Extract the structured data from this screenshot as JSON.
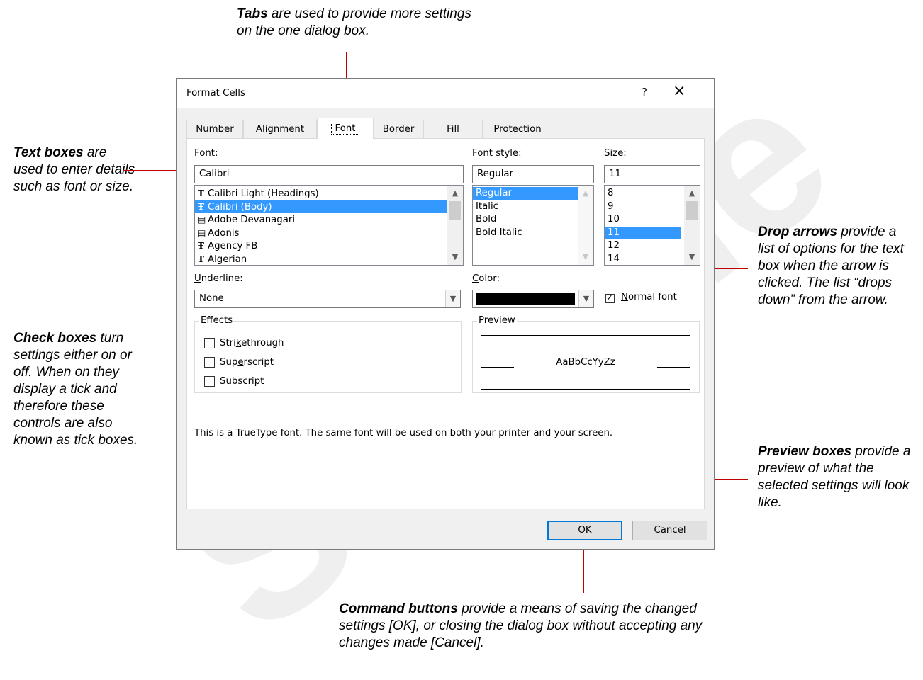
{
  "annotations": {
    "tabs": {
      "bold": "Tabs",
      "text": " are used to provide more settings on the one dialog box."
    },
    "text_boxes": {
      "bold": "Text boxes",
      "text": " are used to enter details such as font or size."
    },
    "check_boxes": {
      "bold": "Check boxes",
      "text": " turn settings either on or off. When on they display a tick and therefore these controls are also known as tick boxes."
    },
    "drop_arrows": {
      "bold": "Drop arrows",
      "text": " provide a list of options for the text box when the arrow is clicked. The list “drops down” from the arrow."
    },
    "preview_boxes": {
      "bold": "Preview boxes",
      "text": " provide a preview of what the selected settings will look like."
    },
    "command_buttons": {
      "bold": "Command buttons",
      "text": " provide a means of saving the changed settings [OK], or closing the dialog box without accepting any changes made [Cancel]."
    }
  },
  "dialog": {
    "title": "Format Cells",
    "help": "?",
    "close": "×",
    "tabs": [
      "Number",
      "Alignment",
      "Font",
      "Border",
      "Fill",
      "Protection"
    ],
    "active_tab": "Font",
    "font": {
      "label_u": "F",
      "label_rest": "ont:",
      "value": "Calibri",
      "items": [
        "Calibri Light (Headings)",
        "Calibri (Body)",
        "Adobe Devanagari",
        "Adonis",
        "Agency FB",
        "Algerian"
      ],
      "item_icons": [
        "truetype-icon",
        "truetype-icon",
        "opentype-icon",
        "opentype-icon",
        "truetype-icon",
        "truetype-icon"
      ],
      "selected": "Calibri (Body)"
    },
    "font_style": {
      "label_pre": "F",
      "label_u": "o",
      "label_rest": "nt style:",
      "value": "Regular",
      "items": [
        "Regular",
        "Italic",
        "Bold",
        "Bold Italic"
      ],
      "selected": "Regular"
    },
    "size": {
      "label_u": "S",
      "label_rest": "ize:",
      "value": "11",
      "items": [
        "8",
        "9",
        "10",
        "11",
        "12",
        "14"
      ],
      "selected": "11"
    },
    "underline": {
      "label_u": "U",
      "label_rest": "nderline:",
      "value": "None"
    },
    "color": {
      "label_u": "C",
      "label_rest": "olor:",
      "swatch": "#000000"
    },
    "normal_font": {
      "label_u": "N",
      "label_rest": "ormal font",
      "checked": true
    },
    "effects": {
      "legend": "Effects",
      "strikethrough": {
        "pre": "Stri",
        "u": "k",
        "post": "ethrough",
        "checked": false
      },
      "superscript": {
        "pre": "Sup",
        "u": "e",
        "post": "rscript",
        "checked": false
      },
      "subscript": {
        "pre": "Su",
        "u": "b",
        "post": "script",
        "checked": false
      }
    },
    "preview": {
      "legend": "Preview",
      "sample": "AaBbCcYyZz"
    },
    "info": "This is a TrueType font.  The same font will be used on both your printer and your screen.",
    "ok_label": "OK",
    "cancel_label": "Cancel"
  },
  "watermark": "Sample",
  "colors": {
    "selection": "#3399ff",
    "callout_line": "#c00000",
    "default_button_border": "#0078d7"
  }
}
